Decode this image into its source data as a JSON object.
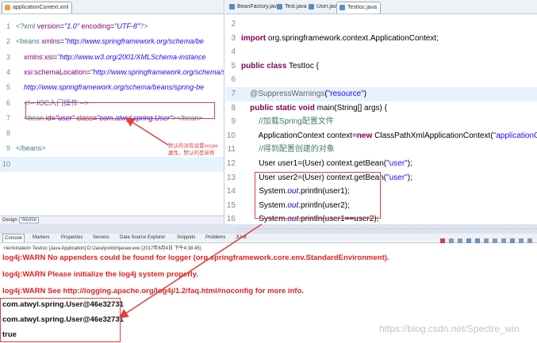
{
  "left_editor": {
    "tab_title": "applicationContext.xml",
    "lines": [
      {
        "n": "1",
        "t": [
          [
            "<?xml ",
            "tag"
          ],
          [
            "version",
            "attr"
          ],
          [
            "=",
            "plain"
          ],
          [
            "\"1.0\"",
            "str"
          ],
          [
            " encoding",
            "attr"
          ],
          [
            "=",
            "plain"
          ],
          [
            "\"UTF-8\"",
            "str"
          ],
          [
            "?>",
            "tag"
          ]
        ]
      },
      {
        "n": "2",
        "t": [
          [
            "<beans ",
            "tag"
          ],
          [
            "xmlns",
            "attr"
          ],
          [
            "=",
            "plain"
          ],
          [
            "\"http://www.springframework.org/schema/be",
            "str"
          ]
        ]
      },
      {
        "n": "3",
        "t": [
          [
            "    xmlns:xsi",
            "attr"
          ],
          [
            "=",
            "plain"
          ],
          [
            "\"http://www.w3.org/2001/XMLSchema-instance",
            "str"
          ]
        ]
      },
      {
        "n": "4",
        "t": [
          [
            "    xsi:schemaLocation",
            "attr"
          ],
          [
            "=",
            "plain"
          ],
          [
            "\"http://www.springframework.org/schema/sc",
            "str"
          ]
        ]
      },
      {
        "n": "5",
        "t": [
          [
            "    http://www.springframework.org/schema/beans/spring-be",
            "str"
          ]
        ]
      },
      {
        "n": "6",
        "t": [
          [
            "    <!-- IOC入门操作 -->",
            "cmt"
          ]
        ]
      },
      {
        "n": "7",
        "t": [
          [
            "    <bean ",
            "tag"
          ],
          [
            "id",
            "attr"
          ],
          [
            "=",
            "plain"
          ],
          [
            "\"user\"",
            "str"
          ],
          [
            " class",
            "attr"
          ],
          [
            "=",
            "plain"
          ],
          [
            "\"com.atwyl.spring.User\"",
            "str"
          ],
          [
            "></bean>",
            "tag"
          ]
        ]
      },
      {
        "n": "8",
        "t": []
      },
      {
        "n": "9",
        "t": [
          [
            "</beans>",
            "tag"
          ]
        ]
      },
      {
        "n": "10",
        "t": []
      }
    ],
    "annotation": "默认的没有设置scope\n属性，默认的是单例",
    "bottom_tabs": [
      "Design",
      "Source"
    ]
  },
  "right_editor": {
    "tabs": [
      "BeanFactory.java",
      "Test.java",
      "User.java",
      "TestIoc.java"
    ],
    "active_tab": "TestIoc.java",
    "lines": [
      {
        "n": "2",
        "t": []
      },
      {
        "n": "3",
        "t": [
          [
            "import ",
            "kw"
          ],
          [
            "org.springframework.context.ApplicationContext;",
            "plain"
          ]
        ]
      },
      {
        "n": "4",
        "t": []
      },
      {
        "n": "5",
        "t": [
          [
            "public ",
            "kw"
          ],
          [
            "class ",
            "kw"
          ],
          [
            "TestIoc {",
            "plain"
          ]
        ]
      },
      {
        "n": "6",
        "t": []
      },
      {
        "n": "7",
        "t": [
          [
            "    @SuppressWarnings",
            "anno"
          ],
          [
            "(",
            "plain"
          ],
          [
            "\"resource\"",
            "jstr"
          ],
          [
            ")",
            "plain"
          ]
        ]
      },
      {
        "n": "8",
        "t": [
          [
            "    public ",
            "kw"
          ],
          [
            "static ",
            "kw"
          ],
          [
            "void ",
            "kw"
          ],
          [
            "main(String[] args) {",
            "plain"
          ]
        ]
      },
      {
        "n": "9",
        "t": [
          [
            "        //加载Spring配置文件",
            "jcmt"
          ]
        ]
      },
      {
        "n": "10",
        "t": [
          [
            "        ApplicationContext context=",
            "plain"
          ],
          [
            "new ",
            "kw"
          ],
          [
            "ClassPathXmlApplicationContext(",
            "plain"
          ],
          [
            "\"applicationCo",
            "jstr"
          ]
        ]
      },
      {
        "n": "11",
        "t": [
          [
            "        //得到配置创建的对象",
            "jcmt"
          ]
        ]
      },
      {
        "n": "12",
        "t": [
          [
            "        User user1=(User) context.getBean(",
            "plain"
          ],
          [
            "\"user\"",
            "jstr"
          ],
          [
            ");",
            "plain"
          ]
        ]
      },
      {
        "n": "13",
        "t": [
          [
            "        User user2=(User) context.getBean(",
            "plain"
          ],
          [
            "\"user\"",
            "jstr"
          ],
          [
            ");",
            "plain"
          ]
        ]
      },
      {
        "n": "14",
        "t": [
          [
            "        System.",
            "plain"
          ],
          [
            "out",
            "fld"
          ],
          [
            ".println(user1);",
            "plain"
          ]
        ]
      },
      {
        "n": "15",
        "t": [
          [
            "        System.",
            "plain"
          ],
          [
            "out",
            "fld"
          ],
          [
            ".println(user2);",
            "plain"
          ]
        ]
      },
      {
        "n": "16",
        "t": [
          [
            "        System.",
            "plain"
          ],
          [
            "out",
            "fld"
          ],
          [
            ".println(user1==user2);",
            "plain"
          ]
        ]
      }
    ]
  },
  "console": {
    "tabs": [
      "Console",
      "Markers",
      "Properties",
      "Servers",
      "Data Source Explorer",
      "Snippets",
      "Problems",
      "JUnit"
    ],
    "status": "<terminated> TestIoc [Java Application] D:\\Java\\jre\\bin\\javaw.exe (2017年6月4日 下午4:38:45)",
    "warn_lines": [
      "log4j:WARN No appenders could be found for logger (org.springframework.core.env.StandardEnvironment).",
      "log4j:WARN Please initialize the log4j system properly.",
      "log4j:WARN See http://logging.apache.org/log4j/1.2/faq.html#noconfig for more info."
    ],
    "output_lines": [
      "com.atwyl.spring.User@46e32731",
      "com.atwyl.spring.User@46e32731",
      "true"
    ]
  },
  "watermark": "https://blog.csdn.net/Spectre_win",
  "colors": {
    "annotation_red": "#e04040",
    "warn_red": "#e02020",
    "highlight": "#e8f2fe"
  }
}
